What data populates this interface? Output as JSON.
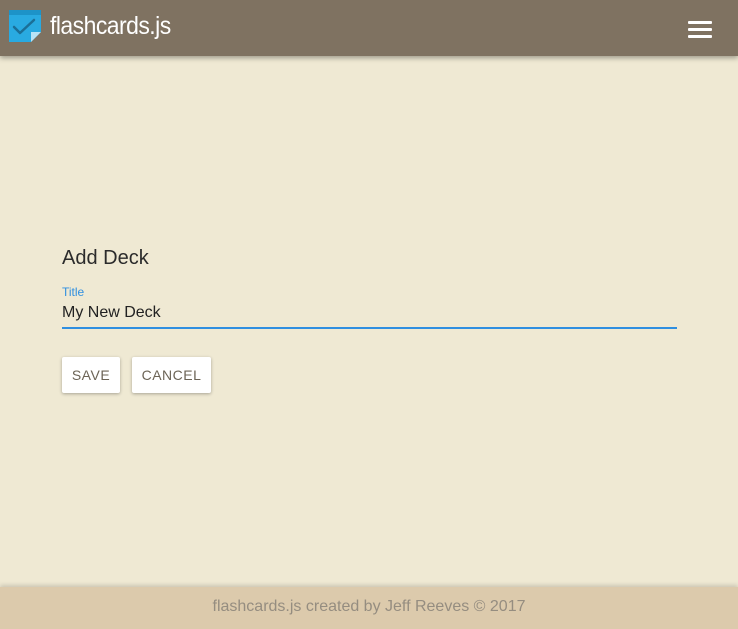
{
  "app": {
    "title": "flashcards.js",
    "logo_icon": "note-check-icon",
    "menu_icon": "hamburger-menu-icon",
    "colors": {
      "app_bar": "#7f7261",
      "background": "#efe9d3",
      "accent": "#2f8fe0",
      "footer": "#dccaac",
      "logo": "#29aae1"
    }
  },
  "form": {
    "heading": "Add Deck",
    "title_field": {
      "label": "Title",
      "value": "My New Deck"
    },
    "save_label": "SAVE",
    "cancel_label": "CANCEL"
  },
  "footer": {
    "text": "flashcards.js created by Jeff Reeves © 2017"
  }
}
